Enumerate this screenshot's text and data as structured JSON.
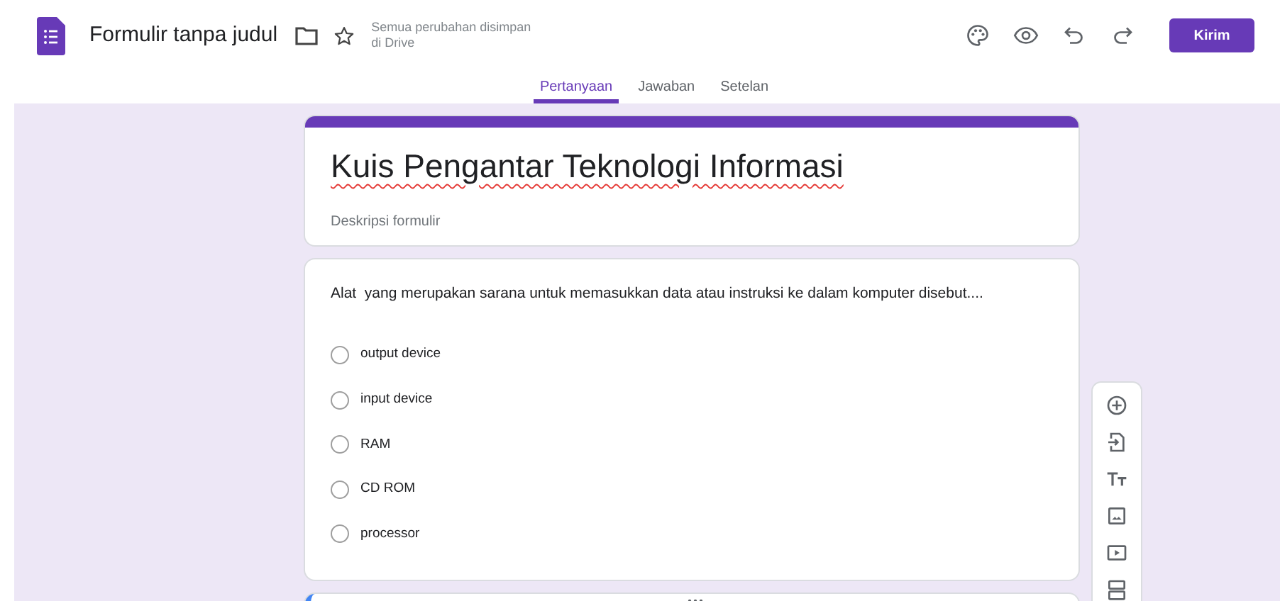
{
  "header": {
    "form_name": "Formulir tanpa judul",
    "save_status": [
      "Semua perubahan disimpan",
      "di Drive"
    ],
    "send_button": "Kirim"
  },
  "tabs": [
    {
      "label": "Pertanyaan",
      "selected": true
    },
    {
      "label": "Jawaban",
      "selected": false
    },
    {
      "label": "Setelan",
      "selected": false
    }
  ],
  "form": {
    "title": "Kuis Pengantar Teknologi Informasi",
    "description_placeholder": "Deskripsi formulir"
  },
  "question": {
    "text": "Alat  yang merupakan sarana untuk memasukkan data atau instruksi ke dalam komputer disebut....",
    "options": [
      {
        "label": "output device",
        "selected": false
      },
      {
        "label": "input device",
        "selected": false
      },
      {
        "label": "RAM",
        "selected": false
      },
      {
        "label": "CD ROM",
        "selected": false
      },
      {
        "label": "processor",
        "selected": false
      }
    ]
  }
}
